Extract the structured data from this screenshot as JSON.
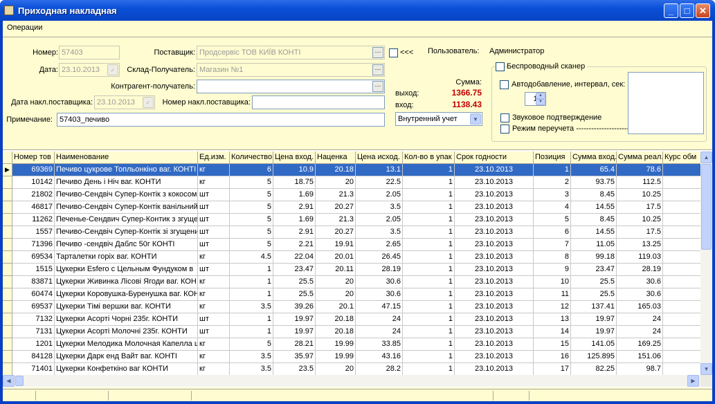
{
  "window": {
    "title": "Приходная накладная"
  },
  "menu": {
    "operations": "Операции"
  },
  "form": {
    "number_label": "Номер:",
    "number_value": "57403",
    "date_label": "Дата:",
    "date_value": "23.10.2013",
    "supplier_label": "Поставщик:",
    "supplier_value": "Продсервіс ТОВ КИЇВ КОНТІ",
    "warehouse_label": "Склад-Получатель:",
    "warehouse_value": "Магазин №1",
    "counterparty_label": "Контрагент-получатель:",
    "counterparty_value": "",
    "supplier_invoice_date_label": "Дата накл.поставщика:",
    "supplier_invoice_date_value": "23.10.2013",
    "supplier_invoice_number_label": "Номер накл.поставщика:",
    "supplier_invoice_number_value": "",
    "note_label": "Примечание:",
    "note_value": "57403_печиво",
    "arrows_label": "<<<",
    "user_label": "Пользователь:",
    "user_value": "Администратор",
    "sum_label": "Сумма:",
    "out_label": "выход:",
    "out_value": "1366.75",
    "in_label": "вход:",
    "in_value": "1138.43",
    "accounting_value": "Внутренний учет",
    "wireless_label": "Беспроводный сканер",
    "autoadd_label": "Автодобавление, интервал, сек:",
    "interval_value": "1",
    "sound_label": "Звуковое подтверждение",
    "recount_label": "Режим переучета ----------------------->",
    "highlight_color": "#c00000"
  },
  "grid": {
    "columns": [
      "Номер тов",
      "Наименование",
      "Ед.изм.",
      "Количество",
      "Цена вход.",
      "Наценка",
      "Цена исход.",
      "Кол-во в упак",
      "Срок годности",
      "Позиция",
      "Сумма вход.",
      "Сумма реал.",
      "Курс обм"
    ],
    "rows": [
      [
        "69369",
        "Печиво цукрове Топльонкіно ваг. КОНТІ",
        "кг",
        "6",
        "10.9",
        "20.18",
        "13.1",
        "1",
        "23.10.2013",
        "1",
        "65.4",
        "78.6"
      ],
      [
        "10142",
        "Печиво День і Ніч ваг. КОНТИ",
        "кг",
        "5",
        "18.75",
        "20",
        "22.5",
        "1",
        "23.10.2013",
        "2",
        "93.75",
        "112.5"
      ],
      [
        "21802",
        "Печиво-Сендвіч Супер-Контік з кокосом",
        "шт",
        "5",
        "1.69",
        "21.3",
        "2.05",
        "1",
        "23.10.2013",
        "3",
        "8.45",
        "10.25"
      ],
      [
        "46817",
        "Печиво-Сендвіч Супер-Контік ванільний с",
        "шт",
        "5",
        "2.91",
        "20.27",
        "3.5",
        "1",
        "23.10.2013",
        "4",
        "14.55",
        "17.5"
      ],
      [
        "11262",
        "Печенье-Сендвич Супер-Контик з згущен",
        "шт",
        "5",
        "1.69",
        "21.3",
        "2.05",
        "1",
        "23.10.2013",
        "5",
        "8.45",
        "10.25"
      ],
      [
        "1557",
        "Печиво-Сендвіч Супер-Контік зі згущени",
        "шт",
        "5",
        "2.91",
        "20.27",
        "3.5",
        "1",
        "23.10.2013",
        "6",
        "14.55",
        "17.5"
      ],
      [
        "71396",
        "Печиво -сендвіч Даблс 50г КОНТІ",
        "шт",
        "5",
        "2.21",
        "19.91",
        "2.65",
        "1",
        "23.10.2013",
        "7",
        "11.05",
        "13.25"
      ],
      [
        "69534",
        "Тарталетки  горіх ваг.  КОНТИ",
        "кг",
        "4.5",
        "22.04",
        "20.01",
        "26.45",
        "1",
        "23.10.2013",
        "8",
        "99.18",
        "119.03"
      ],
      [
        "1515",
        "Цукерки  Esfero с Цельным Фундуком в",
        "шт",
        "1",
        "23.47",
        "20.11",
        "28.19",
        "1",
        "23.10.2013",
        "9",
        "23.47",
        "28.19"
      ],
      [
        "83871",
        "Цукерки Живинка Лісові Ягоди ваг. КОН",
        "кг",
        "1",
        "25.5",
        "20",
        "30.6",
        "1",
        "23.10.2013",
        "10",
        "25.5",
        "30.6"
      ],
      [
        "60474",
        "Цукерки Коровушка-Буренушка ваг. КОН",
        "кг",
        "1",
        "25.5",
        "20",
        "30.6",
        "1",
        "23.10.2013",
        "11",
        "25.5",
        "30.6"
      ],
      [
        "69537",
        "Цукерки Тімі вершки  ваг. КОНТИ",
        "кг",
        "3.5",
        "39.26",
        "20.1",
        "47.15",
        "1",
        "23.10.2013",
        "12",
        "137.41",
        "165.03"
      ],
      [
        "7132",
        "Цукерки Асорті Чорні 235г. КОНТИ",
        "шт",
        "1",
        "19.97",
        "20.18",
        "24",
        "1",
        "23.10.2013",
        "13",
        "19.97",
        "24"
      ],
      [
        "7131",
        "Цукерки Асорті Молочні 235г. КОНТИ",
        "шт",
        "1",
        "19.97",
        "20.18",
        "24",
        "1",
        "23.10.2013",
        "14",
        "19.97",
        "24"
      ],
      [
        "1201",
        "Цукерки Мелодика Молочная Капелла ш",
        "кг",
        "5",
        "28.21",
        "19.99",
        "33.85",
        "1",
        "23.10.2013",
        "15",
        "141.05",
        "169.25"
      ],
      [
        "84128",
        "Цукерки Дарк енд Вайт ваг. КОНТІ",
        "кг",
        "3.5",
        "35.97",
        "19.99",
        "43.16",
        "1",
        "23.10.2013",
        "16",
        "125.895",
        "151.06"
      ],
      [
        "71401",
        "Цукерки Конфеткіно ваг  КОНТИ",
        "кг",
        "3.5",
        "23.5",
        "20",
        "28.2",
        "1",
        "23.10.2013",
        "17",
        "82.25",
        "98.7"
      ]
    ]
  }
}
